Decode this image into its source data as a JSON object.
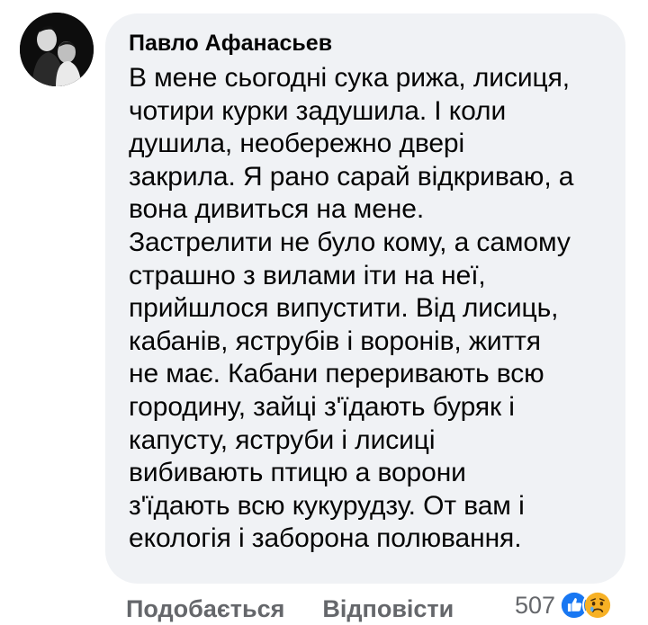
{
  "comment": {
    "author": "Павло Афанасьев",
    "text": "В мене сьогодні сука рижа, лисиця,\nчотири курки задушила. І коли\nдушила, необережно двері\nзакрила. Я рано сарай відкриваю, а\nвона дивиться на мене.\nЗастрелити не було кому, а самому\nстрашно з вилами іти на неї,\nприйшлося випустити. Від лисиць,\nкабанів, яструбів і воронів, життя\nне має. Кабани переривають всю\nгородину, зайці з'їдають буряк і\nкапусту, яструби і лисиці\nвибивають птицю а ворони\nз'їдають всю кукурудзу. От вам і\nекологія і заборона полювання."
  },
  "actions": {
    "like_label": "Подобається",
    "reply_label": "Відповісти"
  },
  "reactions": {
    "count": "507",
    "icons": [
      "like-icon",
      "sad-icon"
    ],
    "colors": {
      "like": "#1877f2",
      "sad": "#f7b125"
    }
  },
  "colors": {
    "bubble": "#f0f2f5",
    "text": "#050505",
    "secondary": "#65676b"
  }
}
